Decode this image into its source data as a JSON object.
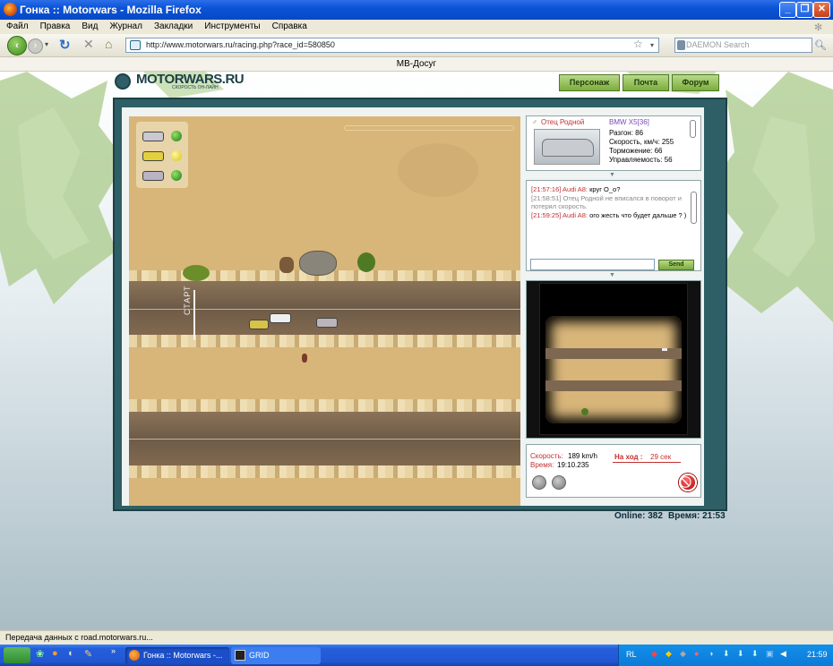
{
  "window": {
    "title": "Гонка :: Motorwars - Mozilla Firefox"
  },
  "menu": [
    "Файл",
    "Правка",
    "Вид",
    "Журнал",
    "Закладки",
    "Инструменты",
    "Справка"
  ],
  "navbar": {
    "url": "http://www.motorwars.ru/racing.php?race_id=580850",
    "search_placeholder": "DAEMON Search"
  },
  "tab_title": "МВ-Досуг",
  "site": {
    "logo_text": "MOTORWARS.RU",
    "logo_sub": "СКОРОСТЬ ОН-ЛАЙН",
    "nav": [
      "Персонаж",
      "Почта",
      "Форум"
    ]
  },
  "car_info": {
    "driver": "Отец Родной",
    "model": "BMW X5[36]",
    "stats": [
      "Разгон: 86",
      "Скорость, км/ч: 255",
      "Торможение: 66",
      "Управляемость: 56"
    ]
  },
  "chat": {
    "messages": [
      {
        "time": "[21:57:16]",
        "author": "Audi A8:",
        "text": "круг О_о?"
      },
      {
        "time": "[21:58:51]",
        "author": "",
        "text": "Отец Родной не вписался в поворот и потерял скорость."
      },
      {
        "time": "[21:59:25]",
        "author": "Audi A8:",
        "text": "ого жесть что будет дальше ? )"
      }
    ],
    "input_value": "",
    "send_label": "Send"
  },
  "race_status": {
    "speed_label": "Скорость:",
    "speed_value": "189 km/h",
    "time_label": "Время:",
    "time_value": "19:10.235",
    "turn_label": "На ход :",
    "turn_value": "29 сек"
  },
  "track": {
    "start_label": "СТАРТ"
  },
  "footer": {
    "online": "Online: 382",
    "time": "Время: 21:53"
  },
  "statusbar": "Передача данных с road.motorwars.ru...",
  "taskbar": {
    "items": [
      "Гонка :: Motorwars -...",
      "GRID"
    ],
    "lang": "RL",
    "clock": "21:59"
  },
  "colors": {
    "accent_green": "#7bac3c",
    "frame_teal": "#2f5f66",
    "sand": "#d8b67a",
    "chat_red": "#c23030"
  }
}
